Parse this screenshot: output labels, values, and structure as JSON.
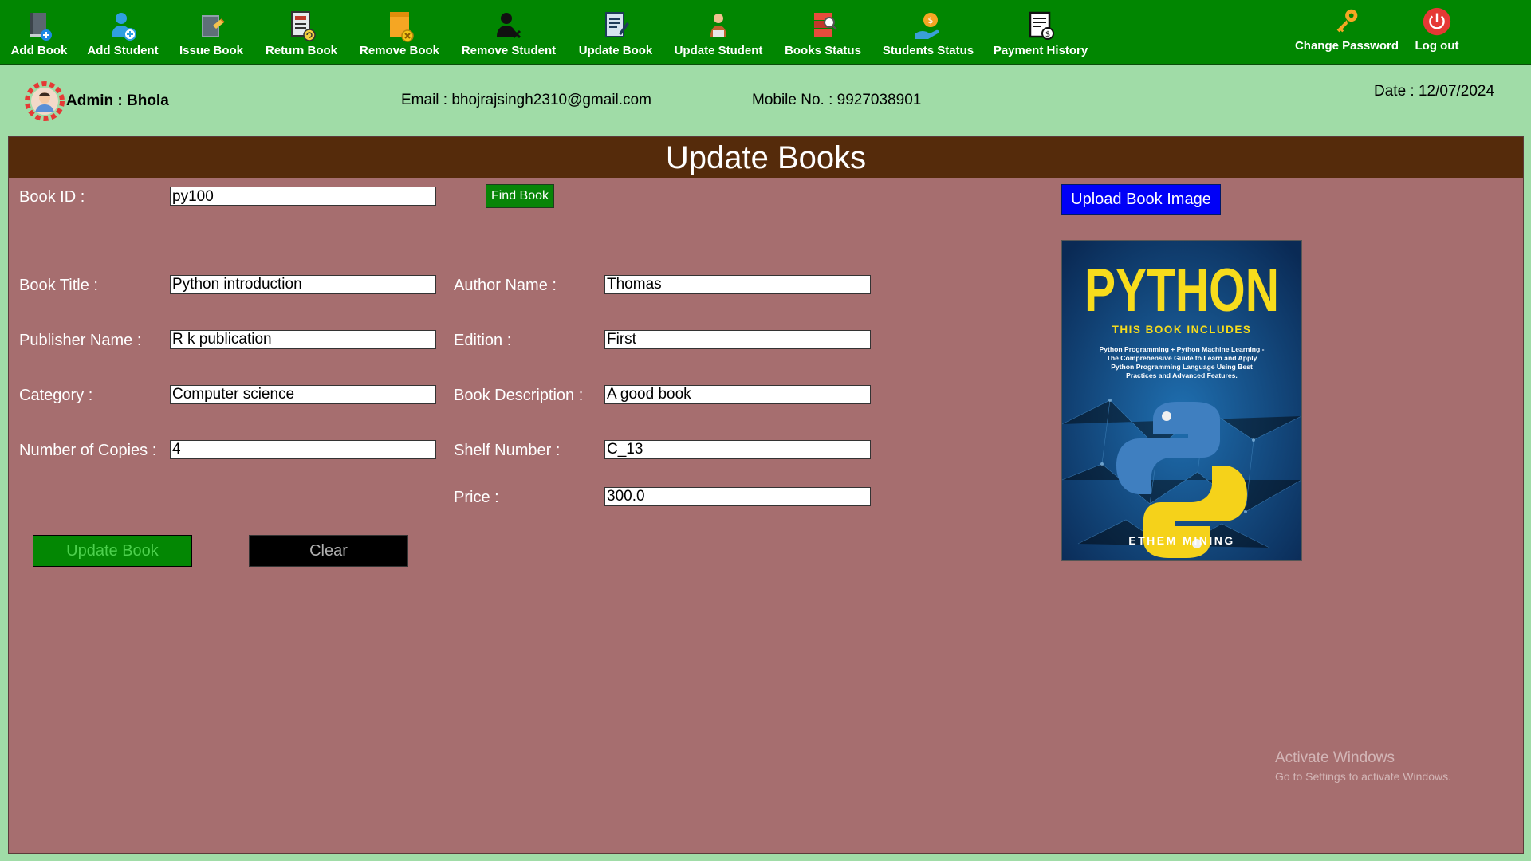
{
  "toolbar": {
    "items": [
      {
        "label": "Add Book",
        "icon": "add-book-icon"
      },
      {
        "label": "Add Student",
        "icon": "add-student-icon"
      },
      {
        "label": "Issue Book",
        "icon": "issue-book-icon"
      },
      {
        "label": "Return Book",
        "icon": "return-book-icon"
      },
      {
        "label": "Remove Book",
        "icon": "remove-book-icon"
      },
      {
        "label": "Remove Student",
        "icon": "remove-student-icon"
      },
      {
        "label": "Update Book",
        "icon": "update-book-icon"
      },
      {
        "label": "Update Student",
        "icon": "update-student-icon"
      },
      {
        "label": "Books Status",
        "icon": "books-status-icon"
      },
      {
        "label": "Students Status",
        "icon": "students-status-icon"
      },
      {
        "label": "Payment History",
        "icon": "payment-history-icon"
      },
      {
        "label": "Change Password",
        "icon": "key-icon"
      },
      {
        "label": "Log out",
        "icon": "power-icon"
      }
    ]
  },
  "admin": {
    "name": "Admin : Bhola",
    "email": "Email : bhojrajsingh2310@gmail.com",
    "mobile": "Mobile No. : 9927038901",
    "date": "Date : 12/07/2024"
  },
  "panel": {
    "title": "Update Books",
    "fields": {
      "book_id": {
        "label": "Book ID :",
        "value": "py100"
      },
      "book_title": {
        "label": "Book Title :",
        "value": "Python introduction"
      },
      "author_name": {
        "label": "Author Name :",
        "value": "Thomas"
      },
      "publisher_name": {
        "label": "Publisher Name :",
        "value": "R k publication"
      },
      "edition": {
        "label": "Edition :",
        "value": "First"
      },
      "category": {
        "label": "Category :",
        "value": "Computer science"
      },
      "book_description": {
        "label": "Book Description :",
        "value": "A good book"
      },
      "number_of_copies": {
        "label": "Number of Copies :",
        "value": "4"
      },
      "shelf_number": {
        "label": "Shelf Number :",
        "value": "C_13"
      },
      "price": {
        "label": "Price :",
        "value": "300.0"
      }
    },
    "buttons": {
      "find_book": "Find Book",
      "upload_image": "Upload Book Image",
      "update_book": "Update Book",
      "clear": "Clear"
    },
    "book_cover": {
      "title": "PYTHON",
      "subtitle": "THIS BOOK INCLUDES",
      "blurb_line1": "Python Programming + Python Machine Learning -",
      "blurb_line2": "The Comprehensive Guide to Learn and Apply",
      "blurb_line3": "Python Programming Language Using Best",
      "blurb_line4": "Practices and Advanced Features.",
      "author": "ETHEM MINING"
    }
  },
  "watermark": {
    "line1": "Activate Windows",
    "line2": "Go to Settings to activate Windows."
  },
  "colors": {
    "toolbar_bg": "#018601",
    "page_bg": "#a0dca7",
    "panel_bg": "#a66e6f",
    "panel_header_bg": "#552b0b",
    "upload_button_bg": "#0000f7"
  }
}
